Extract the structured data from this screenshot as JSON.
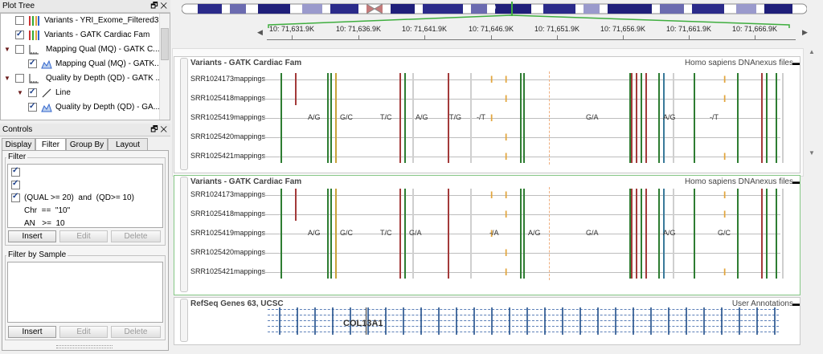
{
  "plot_tree": {
    "title": "Plot Tree",
    "items": [
      {
        "label": "Variants - YRI_Exome_Filtered3",
        "checked": false
      },
      {
        "label": "Variants - GATK Cardiac Fam",
        "checked": false
      },
      {
        "label": "Mapping Qual (MQ) - GATK C...",
        "checked": false
      },
      {
        "label": "Mapping Qual (MQ) - GATK...",
        "checked": true
      },
      {
        "label": "Quality by Depth (QD) - GATK ...",
        "checked": false
      },
      {
        "label": "Line",
        "checked": true
      },
      {
        "label": "Quality by Depth (QD) - GA...",
        "checked": true
      }
    ]
  },
  "controls": {
    "title": "Controls",
    "tabs": [
      "Display",
      "Filter",
      "Group By",
      "Layout"
    ],
    "active_tab": "Filter",
    "filter_group": "Filter",
    "filters": [
      {
        "text": "(QUAL >= 20)  and  (QD>= 10)",
        "checked": true
      },
      {
        "text": "Chr  ==  \"10\"",
        "checked": true
      },
      {
        "text": "AN   >=  10",
        "checked": true
      }
    ],
    "filter_buttons": {
      "insert": "Insert",
      "edit": "Edit",
      "delete": "Delete"
    },
    "sample_group": "Filter by Sample",
    "sample_buttons": {
      "insert": "Insert",
      "edit": "Edit",
      "delete": "Delete"
    }
  },
  "chromosome": {
    "label": "10"
  },
  "ruler": {
    "ticks": [
      "10: 71,631.9K",
      "10: 71,636.9K",
      "10: 71,641.9K",
      "10: 71,646.9K",
      "10: 71,651.9K",
      "10: 71,656.9K",
      "10: 71,661.9K",
      "10: 71,666.9K"
    ]
  },
  "track1": {
    "title": "Variants - GATK Cardiac Fam",
    "source": "Homo sapiens DNAnexus files",
    "samples": [
      "SRR1024173mappings",
      "SRR1025418mappings",
      "SRR1025419mappings",
      "SRR1025420mappings",
      "SRR1025421mappings"
    ],
    "annotations": [
      "A/G",
      "G/C",
      "T/C",
      "A/G",
      "T/G",
      "-/T",
      "G/A",
      "A/G",
      "-/T"
    ]
  },
  "track2": {
    "title": "Variants - GATK Cardiac Fam",
    "source": "Homo sapiens DNAnexus files",
    "samples": [
      "SRR1024173mappings",
      "SRR1025418mappings",
      "SRR1025419mappings",
      "SRR1025420mappings",
      "SRR1025421mappings"
    ],
    "annotations": [
      "A/G",
      "G/C",
      "T/C",
      "G/A",
      "-/A",
      "A/G",
      "G/A",
      "A/G",
      "G/C"
    ]
  },
  "track3": {
    "title": "RefSeq Genes 63, UCSC",
    "source": "User Annotations",
    "gene": "COL13A1"
  },
  "colors": {
    "green": "#2e7d32",
    "red": "#a33a3a",
    "orange": "#e2a53c",
    "gray": "#cfcfcf",
    "highlight": "#86c786"
  }
}
